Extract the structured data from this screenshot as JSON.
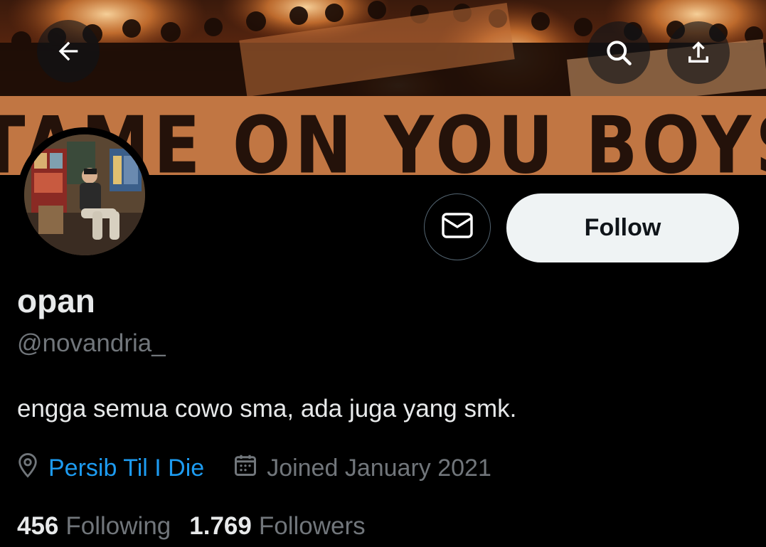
{
  "header": {
    "back_icon": "arrow-left-icon",
    "search_icon": "search-icon",
    "share_icon": "share-icon",
    "banner_text": "TAME ON YOU BOYS IN BLUE"
  },
  "profile": {
    "display_name": "opan",
    "handle": "@novandria_",
    "bio": "engga semua cowo sma, ada juga yang smk.",
    "location": "Persib Til I Die",
    "joined": "Joined January 2021",
    "following_count": "456",
    "following_label": "Following",
    "followers_count": "1.769",
    "followers_label": "Followers"
  },
  "actions": {
    "message_icon": "envelope-icon",
    "follow_label": "Follow"
  },
  "colors": {
    "background": "#000000",
    "primary_text": "#e7e9ea",
    "secondary_text": "#71767b",
    "link": "#1d9bf0",
    "follow_button_bg": "#eff3f4",
    "follow_button_text": "#0f1419"
  }
}
